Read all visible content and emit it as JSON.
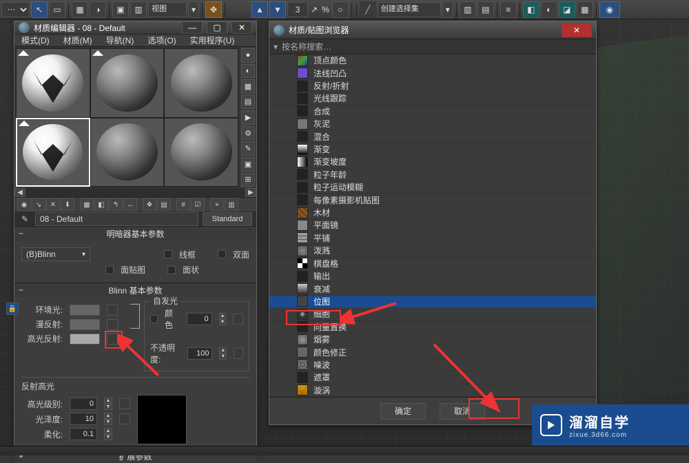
{
  "toolbar": {
    "view_combo": "视图",
    "spinner1": "3",
    "selection_set": "创建选择集"
  },
  "materialEditor": {
    "title": "材质编辑器 - 08 - Default",
    "menus": [
      "模式(D)",
      "材质(M)",
      "导航(N)",
      "选项(O)",
      "实用程序(U)"
    ],
    "name_field": "08 - Default",
    "type_btn": "Standard",
    "rollout_shader_title": "明暗器基本参数",
    "shader_combo": "(B)Blinn",
    "chk_wire": "线框",
    "chk_2side": "双面",
    "chk_facemap": "面贴图",
    "chk_faceted": "面状",
    "rollout_blinn_title": "Blinn 基本参数",
    "selfillum_group": "自发光",
    "chk_color": "颜色",
    "ambient_label": "环境光:",
    "diffuse_label": "漫反射:",
    "specular_label": "高光反射:",
    "opacity_label": "不透明度:",
    "selfillum_spin": "0",
    "opacity_spin": "100",
    "highlight_group": "反射高光",
    "spec_level_label": "高光级别:",
    "gloss_label": "光泽度:",
    "soften_label": "柔化:",
    "spec_level_spin": "0",
    "gloss_spin": "10",
    "soften_spin": "0.1",
    "rollout_ext_title": "扩展参数"
  },
  "mapBrowser": {
    "title": "材质/贴图浏览器",
    "search_placeholder": "按名称搜索…",
    "items": [
      {
        "label": "顶点颜色",
        "swatch": "linear-gradient(135deg,#a33,#3a3,#33a)"
      },
      {
        "label": "法线凹凸",
        "swatch": "#6a4dd0"
      },
      {
        "label": "反射/折射",
        "swatch": "#222"
      },
      {
        "label": "光线跟踪",
        "swatch": "#222"
      },
      {
        "label": "合成",
        "swatch": "#222"
      },
      {
        "label": "灰泥",
        "swatch": "#777"
      },
      {
        "label": "混合",
        "swatch": "#222"
      },
      {
        "label": "渐变",
        "swatch": "linear-gradient(#fff,#000)"
      },
      {
        "label": "渐变坡度",
        "swatch": "linear-gradient(90deg,#fff,#000)"
      },
      {
        "label": "粒子年龄",
        "swatch": "#222"
      },
      {
        "label": "粒子运动模糊",
        "swatch": "#222"
      },
      {
        "label": "每像素摄影机贴图",
        "swatch": "#222"
      },
      {
        "label": "木材",
        "swatch": "repeating-linear-gradient(45deg,#8a5a2a 0 3px,#6d4015 3px 6px)"
      },
      {
        "label": "平面镜",
        "swatch": "#888"
      },
      {
        "label": "平铺",
        "swatch": "repeating-linear-gradient(0deg,#999 0 4px,#555 4px 5px)"
      },
      {
        "label": "泼溅",
        "swatch": "radial-gradient(circle,#888,#555)"
      },
      {
        "label": "棋盘格",
        "swatch": "repeating-conic-gradient(#fff 0 25%,#000 0 50%)"
      },
      {
        "label": "输出",
        "swatch": "#222"
      },
      {
        "label": "衰减",
        "swatch": "linear-gradient(#ccc,#333)"
      },
      {
        "label": "位图",
        "swatch": "#444",
        "selected": true
      },
      {
        "label": "细胞",
        "swatch": "radial-gradient(circle,#888 30%,#333 31%)"
      },
      {
        "label": "向量置换",
        "swatch": "#222"
      },
      {
        "label": "烟雾",
        "swatch": "radial-gradient(circle,#999,#555)"
      },
      {
        "label": "颜色修正",
        "swatch": "#666"
      },
      {
        "label": "噪波",
        "swatch": "repeating-radial-gradient(#777 0 2px,#555 2px 4px)"
      },
      {
        "label": "遮罩",
        "swatch": "#222"
      },
      {
        "label": "漩涡",
        "swatch": "conic-gradient(#c90,#a60,#c90)"
      }
    ],
    "ok": "确定",
    "cancel": "取消"
  },
  "watermark": {
    "big": "溜溜自学",
    "small": "zixue.3d66.com"
  }
}
